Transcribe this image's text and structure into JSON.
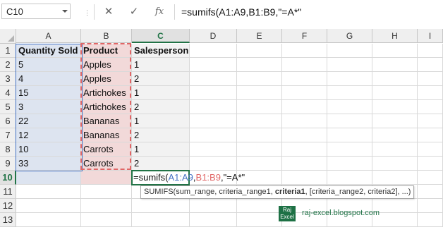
{
  "name_box": "C10",
  "formula": "=sumifs(A1:A9,B1:B9,\"=A*\"",
  "columns": [
    "A",
    "B",
    "C",
    "D",
    "E",
    "F",
    "G",
    "H",
    "I"
  ],
  "rows": [
    "1",
    "2",
    "3",
    "4",
    "5",
    "6",
    "7",
    "8",
    "9",
    "10",
    "11",
    "12",
    "13"
  ],
  "headers": [
    "Quantity Sold",
    "Product",
    "Salesperson"
  ],
  "data": [
    [
      "5",
      "Apples",
      "1"
    ],
    [
      "4",
      "Apples",
      "2"
    ],
    [
      "15",
      "Artichokes",
      "1"
    ],
    [
      "3",
      "Artichokes",
      "2"
    ],
    [
      "22",
      "Bananas",
      "1"
    ],
    [
      "12",
      "Bananas",
      "2"
    ],
    [
      "10",
      "Carrots",
      "1"
    ],
    [
      "33",
      "Carrots",
      "2"
    ]
  ],
  "edit": {
    "prefix": "=sumifs(",
    "ref_a": "A1:A9",
    "sep1": ",",
    "ref_b": "B1:B9",
    "suffix": ",\"=A*\""
  },
  "tooltip": {
    "pre": "SUMIFS(sum_range, criteria_range1, ",
    "bold": "criteria1",
    "post": ", [criteria_range2, criteria2], ...)"
  },
  "logo": {
    "line1": "Raj",
    "line2": "Excel"
  },
  "watermark": "raj-excel.blogspot.com",
  "colors": {
    "accent": "#217346",
    "ref_a": "#4472c4",
    "ref_b": "#e06666"
  }
}
